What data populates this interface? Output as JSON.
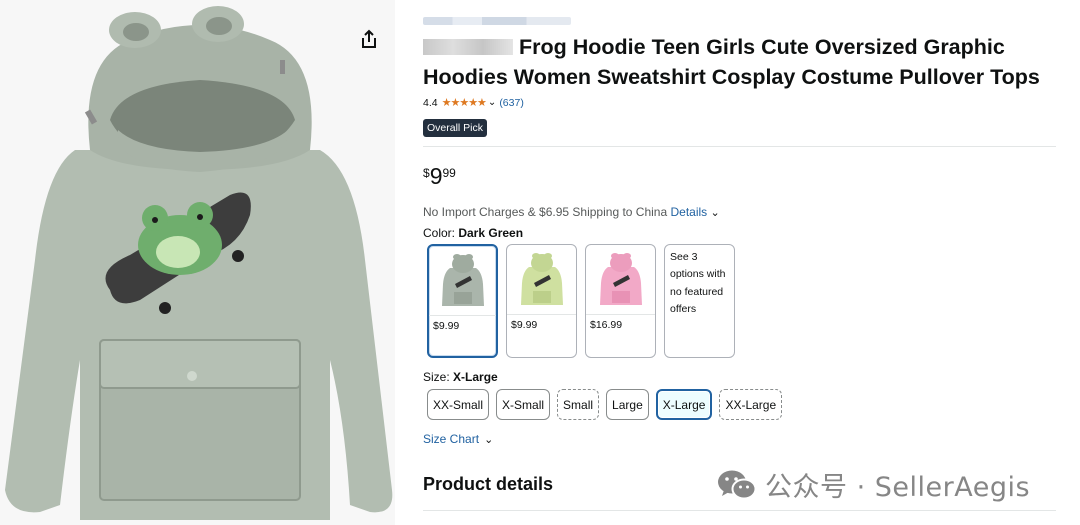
{
  "image": {
    "alt": "",
    "share_icon": "share-icon"
  },
  "product": {
    "title": "Frog Hoodie Teen Girls Cute Oversized Graphic Hoodies Women Sweatshirt Cosplay Costume Pullover Tops",
    "rating": "4.4",
    "stars": "★★★★★",
    "rating_value": 4.4,
    "review_count": "(637)",
    "badge": "Overall Pick",
    "price_symbol": "$",
    "price_whole": "9",
    "price_fraction": "99"
  },
  "shipping": {
    "text": "No Import Charges & $6.95 Shipping to China ",
    "details_link": "Details"
  },
  "color": {
    "label": "Color: ",
    "selected": "Dark Green",
    "options": [
      {
        "price": "$9.99",
        "color": "#aab5ab"
      },
      {
        "price": "$9.99",
        "color": "#cfe0a0"
      },
      {
        "price": "$16.99",
        "color": "#f2a9c7"
      }
    ],
    "more_options": "See 3 options with no featured offers"
  },
  "size": {
    "label": "Size: ",
    "selected": "X-Large",
    "options": [
      {
        "label": "XX-Small",
        "style": "solid"
      },
      {
        "label": "X-Small",
        "style": "solid"
      },
      {
        "label": "Small",
        "style": "dashed"
      },
      {
        "label": "Large",
        "style": "solid"
      },
      {
        "label": "X-Large",
        "style": "selected"
      },
      {
        "label": "XX-Large",
        "style": "dashed"
      }
    ],
    "chart_link": "Size Chart"
  },
  "section": {
    "product_details": "Product details"
  },
  "watermark": {
    "text": "公众号 · SellerAegis",
    "icon": "wechat-icon"
  },
  "colors": {
    "link": "#2162a1",
    "star": "#de7921",
    "badge_bg": "#232f3e",
    "selected_border": "#2162a1"
  }
}
